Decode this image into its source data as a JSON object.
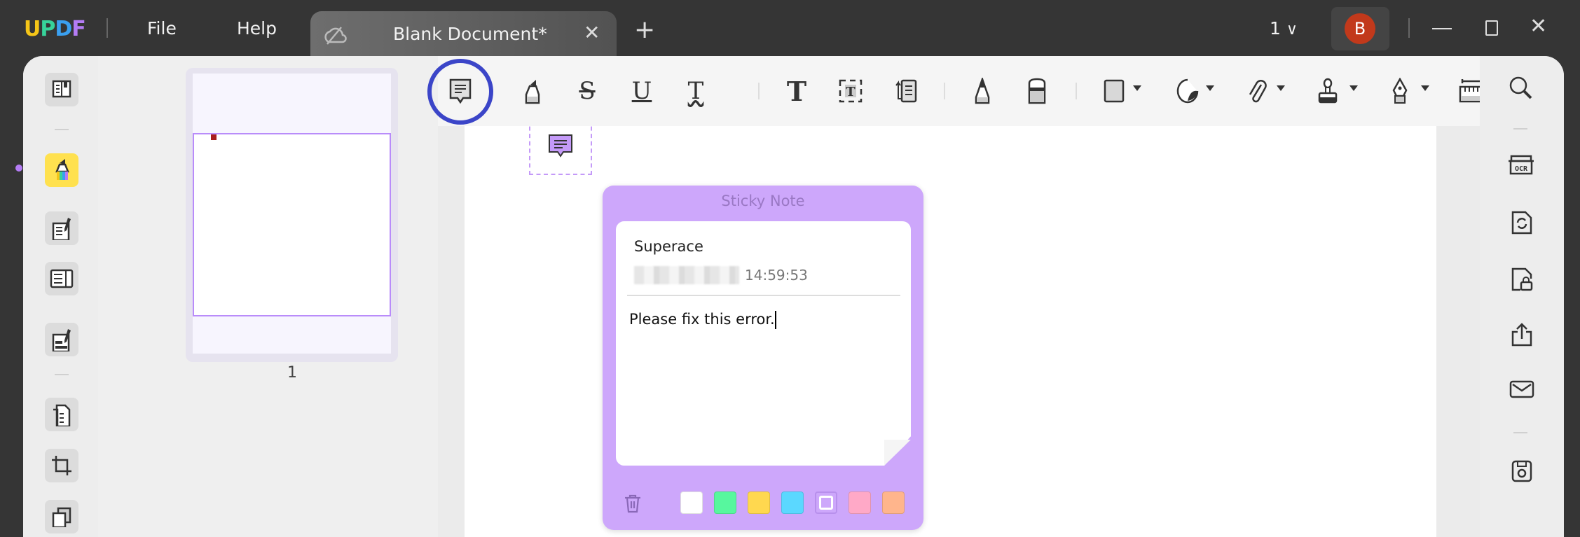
{
  "titlebar": {
    "logo": "UPDF",
    "menu": [
      "File",
      "Help"
    ],
    "tab_title": "Blank Document*",
    "page_indicator": "1",
    "avatar_initial": "B",
    "colors": {
      "avatar": "#c2391b",
      "logo": [
        "#f5c518",
        "#37d39a",
        "#3aa0f0",
        "#b47cf5"
      ]
    }
  },
  "left_rail": {
    "items": [
      "reader",
      "comment",
      "edit",
      "page-layout",
      "fill-sign",
      "organize",
      "crop",
      "watermark"
    ],
    "active": "comment"
  },
  "thumbnails": {
    "page_number": "1"
  },
  "toolbar": {
    "tools": [
      "sticky-note",
      "highlight",
      "strikethrough",
      "underline",
      "squiggly",
      "text",
      "text-box",
      "text-callout",
      "pencil",
      "eraser",
      "shape-rect",
      "shape-polygon",
      "attachment",
      "stamp",
      "signature",
      "measure"
    ],
    "active": "sticky-note",
    "highlight_color": "#3b45c8"
  },
  "right_rail": {
    "items": [
      "search",
      "ocr",
      "convert",
      "protect",
      "share",
      "email",
      "save"
    ]
  },
  "sticky_note": {
    "title": "Sticky Note",
    "author": "Superace",
    "time": "14:59:53",
    "body": "Please fix this error.",
    "background": "#cda7fb",
    "swatches": [
      "#ffffff",
      "#57f79e",
      "#ffd84f",
      "#5bd8ff",
      "#cda7fb",
      "#ffa9c7",
      "#ffb58c"
    ],
    "selected_swatch": 4
  }
}
